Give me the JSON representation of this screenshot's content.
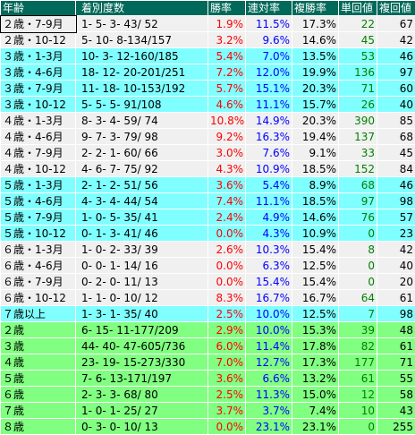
{
  "header": [
    "年齢",
    "着別度数",
    "勝率",
    "連対率",
    "複勝率",
    "単回値",
    "複回値"
  ],
  "rows": [
    {
      "group": "grey",
      "age": "２歳・7-9月",
      "record": "1-   5-   3-  43/ 52",
      "win": "1.9%",
      "ren": "11.5%",
      "fuk": "17.3%",
      "tan": "22",
      "fukv": "67",
      "highlight": true
    },
    {
      "group": "grey",
      "age": "２歳・10-12",
      "record": "5-  10-   8-134/157",
      "win": "3.2%",
      "ren": "9.6%",
      "fuk": "14.6%",
      "tan": "45",
      "fukv": "42"
    },
    {
      "group": "cyan",
      "age": "３歳・1-3月",
      "record": "10-   3-  12-160/185",
      "win": "5.4%",
      "ren": "7.0%",
      "fuk": "13.5%",
      "tan": "53",
      "fukv": "46"
    },
    {
      "group": "cyan",
      "age": "３歳・4-6月",
      "record": "18-  12-  20-201/251",
      "win": "7.2%",
      "ren": "12.0%",
      "fuk": "19.9%",
      "tan": "136",
      "fukv": "97"
    },
    {
      "group": "cyan",
      "age": "３歳・7-9月",
      "record": "11-  18-  10-153/192",
      "win": "5.7%",
      "ren": "15.1%",
      "fuk": "20.3%",
      "tan": "71",
      "fukv": "60"
    },
    {
      "group": "cyan",
      "age": "３歳・10-12",
      "record": "5-   5-   5-  91/108",
      "win": "4.6%",
      "ren": "11.1%",
      "fuk": "15.7%",
      "tan": "26",
      "fukv": "40"
    },
    {
      "group": "grey",
      "age": "４歳・1-3月",
      "record": "8-   3-   4-  59/ 74",
      "win": "10.8%",
      "ren": "14.9%",
      "fuk": "20.3%",
      "tan": "390",
      "fukv": "85"
    },
    {
      "group": "grey",
      "age": "４歳・4-6月",
      "record": "9-   7-   3-  79/ 98",
      "win": "9.2%",
      "ren": "16.3%",
      "fuk": "19.4%",
      "tan": "137",
      "fukv": "68"
    },
    {
      "group": "grey",
      "age": "４歳・7-9月",
      "record": "2-   2-   1-  60/ 66",
      "win": "3.0%",
      "ren": "7.6%",
      "fuk": "9.1%",
      "tan": "33",
      "fukv": "45"
    },
    {
      "group": "grey",
      "age": "４歳・10-12",
      "record": "4-   6-   7-  75/ 92",
      "win": "4.3%",
      "ren": "10.9%",
      "fuk": "18.5%",
      "tan": "152",
      "fukv": "84"
    },
    {
      "group": "cyan",
      "age": "５歳・1-3月",
      "record": "2-   1-   2-  51/ 56",
      "win": "3.6%",
      "ren": "5.4%",
      "fuk": "8.9%",
      "tan": "68",
      "fukv": "46"
    },
    {
      "group": "cyan",
      "age": "５歳・4-6月",
      "record": "4-   3-   4-  44/ 54",
      "win": "7.4%",
      "ren": "11.1%",
      "fuk": "18.5%",
      "tan": "97",
      "fukv": "98"
    },
    {
      "group": "cyan",
      "age": "５歳・7-9月",
      "record": "1-   0-   5-  35/ 41",
      "win": "2.4%",
      "ren": "4.9%",
      "fuk": "14.6%",
      "tan": "76",
      "fukv": "57"
    },
    {
      "group": "cyan",
      "age": "５歳・10-12",
      "record": "0-   1-   3-  41/ 46",
      "win": "0.0%",
      "ren": "4.3%",
      "fuk": "10.9%",
      "tan": "0",
      "fukv": "23"
    },
    {
      "group": "grey",
      "age": "６歳・1-3月",
      "record": "1-   0-   2-  33/ 39",
      "win": "2.6%",
      "ren": "10.3%",
      "fuk": "15.4%",
      "tan": "8",
      "fukv": "42"
    },
    {
      "group": "grey",
      "age": "６歳・4-6月",
      "record": "0-   0-   1-  14/ 16",
      "win": "0.0%",
      "ren": "6.3%",
      "fuk": "12.5%",
      "tan": "0",
      "fukv": "40"
    },
    {
      "group": "grey",
      "age": "６歳・7-9月",
      "record": "0-   2-   0-  11/ 13",
      "win": "0.0%",
      "ren": "15.4%",
      "fuk": "15.4%",
      "tan": "0",
      "fukv": "20"
    },
    {
      "group": "grey",
      "age": "６歳・10-12",
      "record": "1-   1-   0-  10/ 12",
      "win": "8.3%",
      "ren": "16.7%",
      "fuk": "16.7%",
      "tan": "64",
      "fukv": "61"
    },
    {
      "group": "cyan",
      "age": "７歳以上",
      "record": "1-   3-   1-  35/ 40",
      "win": "2.5%",
      "ren": "10.0%",
      "fuk": "12.5%",
      "tan": "7",
      "fukv": "98"
    },
    {
      "group": "green",
      "age": "２歳",
      "record": "6-  15-  11-177/209",
      "win": "2.9%",
      "ren": "10.0%",
      "fuk": "15.3%",
      "tan": "39",
      "fukv": "48"
    },
    {
      "group": "green",
      "age": "３歳",
      "record": "44-  40-  47-605/736",
      "win": "6.0%",
      "ren": "11.4%",
      "fuk": "17.8%",
      "tan": "82",
      "fukv": "61"
    },
    {
      "group": "green",
      "age": "４歳",
      "record": "23-  19-  15-273/330",
      "win": "7.0%",
      "ren": "12.7%",
      "fuk": "17.3%",
      "tan": "177",
      "fukv": "71"
    },
    {
      "group": "green",
      "age": "５歳",
      "record": "7-   6-  13-171/197",
      "win": "3.6%",
      "ren": "6.6%",
      "fuk": "13.2%",
      "tan": "61",
      "fukv": "55"
    },
    {
      "group": "green",
      "age": "６歳",
      "record": "2-   3-   3-  68/ 80",
      "win": "2.5%",
      "ren": "11.3%",
      "fuk": "15.0%",
      "tan": "12",
      "fukv": "58"
    },
    {
      "group": "green",
      "age": "７歳",
      "record": "1-   0-   1-  25/ 27",
      "win": "3.7%",
      "ren": "3.7%",
      "fuk": "7.4%",
      "tan": "10",
      "fukv": "43"
    },
    {
      "group": "green",
      "age": "８歳",
      "record": "0-   3-   0-  10/ 13",
      "win": "0.0%",
      "ren": "23.1%",
      "fuk": "23.1%",
      "tan": "0",
      "fukv": "255"
    }
  ],
  "colors": {
    "header_bg": "#00695a",
    "grey": "#f0f0f0",
    "cyan": "#7fffff",
    "green": "#80ff80",
    "win_text": "#ff0000",
    "ren_text": "#0000ff",
    "tan_text": "#008000"
  }
}
